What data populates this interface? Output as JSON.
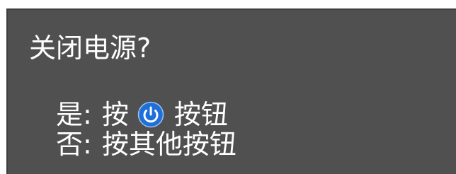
{
  "dialog": {
    "title": "关闭电源?",
    "yes_option": {
      "prefix": "是:",
      "press": "按",
      "icon": "power-icon",
      "suffix": "按钮"
    },
    "no_option": {
      "prefix": "否:",
      "text": "按其他按钮"
    }
  },
  "colors": {
    "dialog_background": "#505050",
    "text": "#ffffff",
    "power_icon": "#1e6fd9"
  }
}
